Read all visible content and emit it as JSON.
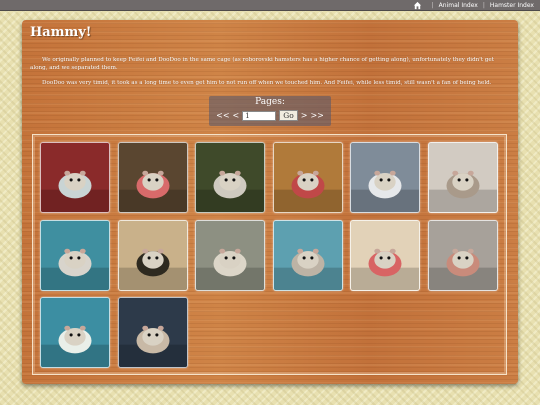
{
  "nav": {
    "home_icon": "home-icon",
    "links": [
      "Animal Index",
      "Hamster Index"
    ]
  },
  "page": {
    "title": "Hammy!",
    "paragraphs": [
      "We originally planned to keep Feifei and DooDoo in the same cage (as roborovski hamsters has a higher chance of getting along), unfortunately they didn't get along, and we separated them.",
      "DooDoo was very timid, it took as a long time to even get him to not run off when we touched him. And Feifei, while less timid, still wasn't a fan of being held."
    ]
  },
  "pager": {
    "label": "Pages:",
    "first": "<<",
    "prev": "<",
    "page_value": "1",
    "go_label": "Go",
    "next": ">",
    "last": ">>"
  },
  "gallery": {
    "thumbnails": [
      {
        "name": "hamster-photo-1",
        "bg": "#8a2a2a",
        "accent": "#c9d4d4"
      },
      {
        "name": "hamster-photo-2",
        "bg": "#5a4630",
        "accent": "#d86a6a"
      },
      {
        "name": "hamster-photo-3",
        "bg": "#3f4a2a",
        "accent": "#cfcac0"
      },
      {
        "name": "hamster-photo-4",
        "bg": "#b07a3a",
        "accent": "#c04848"
      },
      {
        "name": "hamster-photo-5",
        "bg": "#7f8c99",
        "accent": "#e6e8ea"
      },
      {
        "name": "hamster-photo-6",
        "bg": "#d2cbc2",
        "accent": "#a99a8a"
      },
      {
        "name": "hamster-photo-7",
        "bg": "#3f8fa0",
        "accent": "#d8d4cc"
      },
      {
        "name": "hamster-photo-8",
        "bg": "#c9b18a",
        "accent": "#2e2a20"
      },
      {
        "name": "hamster-photo-9",
        "bg": "#8d9082",
        "accent": "#dcd6c8"
      },
      {
        "name": "hamster-photo-10",
        "bg": "#5da0b0",
        "accent": "#bdb3a5"
      },
      {
        "name": "hamster-photo-11",
        "bg": "#e2d2b8",
        "accent": "#d86464"
      },
      {
        "name": "hamster-photo-12",
        "bg": "#a7a19a",
        "accent": "#c98b7b"
      },
      {
        "name": "hamster-photo-13",
        "bg": "#3c8ea2",
        "accent": "#e9efe9"
      },
      {
        "name": "hamster-photo-14",
        "bg": "#2d3a4a",
        "accent": "#c8b9a6"
      }
    ]
  }
}
